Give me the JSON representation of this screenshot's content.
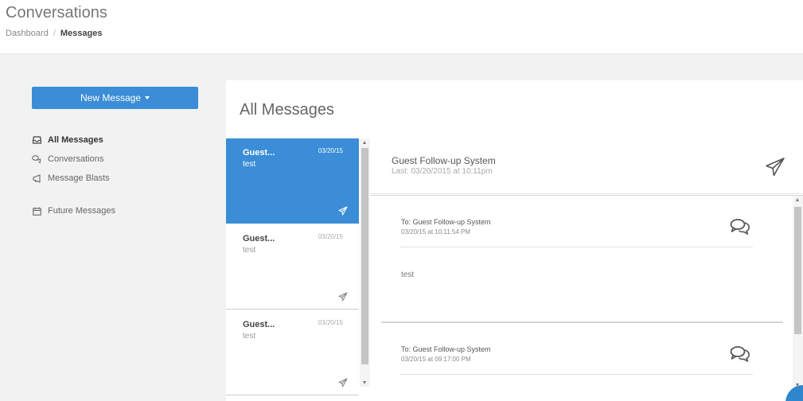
{
  "header": {
    "title": "Conversations",
    "breadcrumb": {
      "parent": "Dashboard",
      "separator": "/",
      "current": "Messages"
    }
  },
  "sidebar": {
    "new_message_label": "New Message",
    "items": [
      {
        "label": "All Messages",
        "icon": "inbox-icon",
        "active": true
      },
      {
        "label": "Conversations",
        "icon": "chat-icon",
        "active": false
      },
      {
        "label": "Message Blasts",
        "icon": "megaphone-icon",
        "active": false
      },
      {
        "label": "Future Messages",
        "icon": "calendar-icon",
        "active": false
      }
    ]
  },
  "main": {
    "title": "All Messages",
    "messages": [
      {
        "sender": "Guest...",
        "date": "03/20/15",
        "preview": "test",
        "selected": true
      },
      {
        "sender": "Guest...",
        "date": "03/20/15",
        "preview": "test",
        "selected": false
      },
      {
        "sender": "Guest...",
        "date": "03/20/15",
        "preview": "test",
        "selected": false
      }
    ],
    "detail": {
      "name": "Guest Follow-up System",
      "last": "Last: 03/20/2015 at 10:11pm",
      "entries": [
        {
          "to": "To: Guest Follow-up System",
          "timestamp": "03/20/15 at 10:11:54 PM",
          "body": "test"
        },
        {
          "to": "To: Guest Follow-up System",
          "timestamp": "03/20/15 at 09:17:00 PM",
          "body": ""
        }
      ]
    }
  },
  "colors": {
    "accent": "#3a8dd6",
    "background": "#f2f2f2",
    "panel": "#ffffff"
  }
}
